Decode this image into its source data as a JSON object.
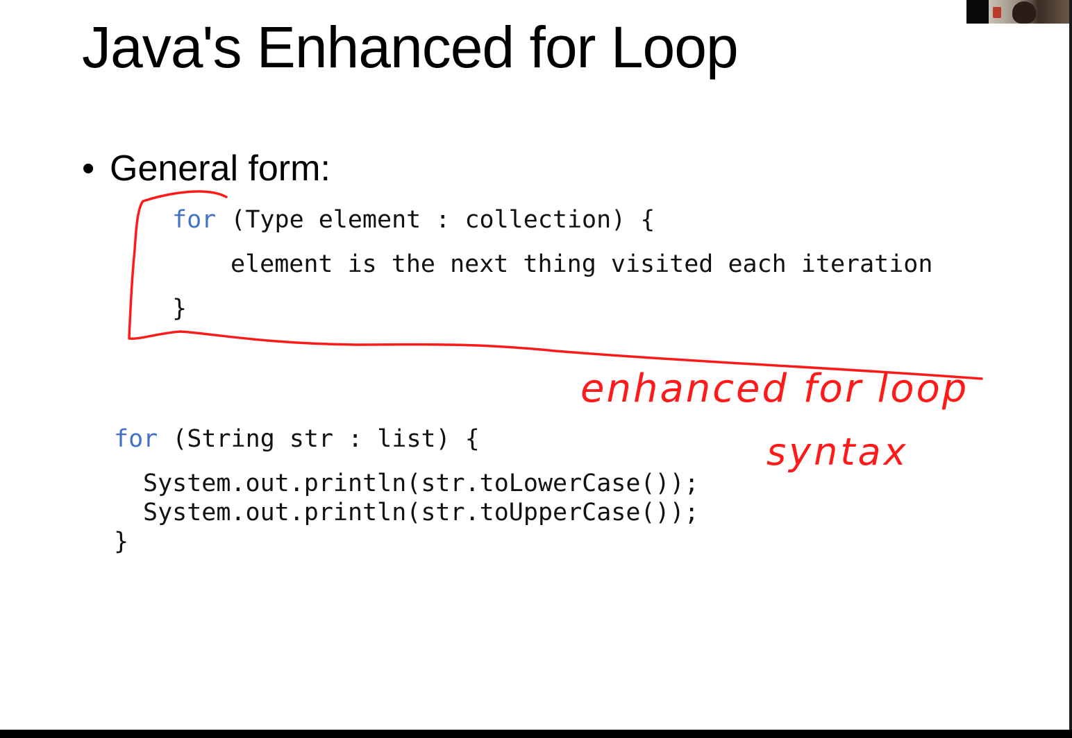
{
  "slide": {
    "title": "Java's Enhanced for Loop",
    "bullet_marker": "•",
    "bullet_text": "General form:"
  },
  "general_form": {
    "line1_keyword": "for",
    "line1_rest": " (Type element : collection) {",
    "line2": "element is the next thing visited each iteration",
    "line3": "}"
  },
  "example": {
    "line1_keyword": "for",
    "line1_rest": " (String str : list) {",
    "line2": "System.out.println(str.toLowerCase());",
    "line3": "System.out.println(str.toUpperCase());",
    "line4": "}"
  },
  "annotations": {
    "line1": "enhanced  for loop",
    "line2": "syntax"
  },
  "colors": {
    "keyword": "#4472c4",
    "ink": "#ff1a1a",
    "text": "#000000"
  }
}
